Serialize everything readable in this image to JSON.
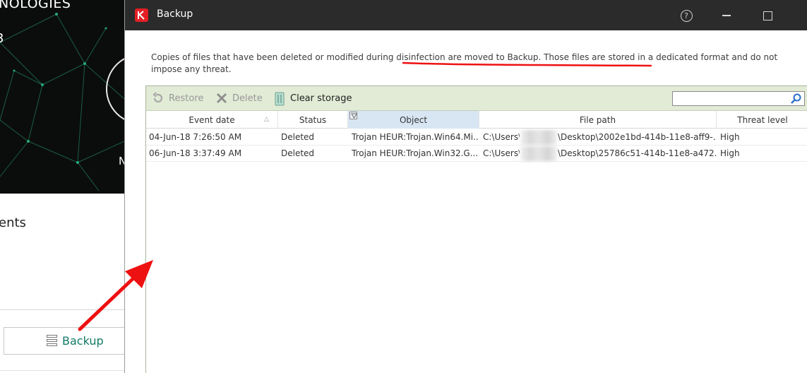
{
  "background_app": {
    "brand_text": "NOLOGIES",
    "brand_sub": "3",
    "n_text": "N",
    "section_text": "ents",
    "backup_button_label": "Backup",
    "backup_icon": "storage-icon"
  },
  "window": {
    "title": "Backup",
    "app_icon": "kaspersky-logo-icon",
    "controls": {
      "help_icon": "help-icon",
      "help_glyph": "?",
      "minimize_icon": "minimize-icon",
      "maximize_icon": "maximize-icon"
    },
    "description": "Copies of files that have been deleted or modified during disinfection are moved to Backup. Those files are stored in a dedicated format and do not impose any threat."
  },
  "toolbar": {
    "restore_label": "Restore",
    "delete_label": "Delete",
    "clear_label": "Clear storage",
    "search_value": "",
    "search_icon": "search-icon"
  },
  "table": {
    "columns": [
      "Event date",
      "Status",
      "Object",
      "File path",
      "Threat level"
    ],
    "sorted_column": "Event date",
    "active_column": "Object",
    "rows": [
      {
        "date": "04-Jun-18 7:26:50 AM",
        "status": "Deleted",
        "object": "Trojan HEUR:Trojan.Win64.Mi...",
        "path_start": "C:\\Users\\",
        "path_end": "\\Desktop\\2002e1bd-414b-11e8-aff9-...",
        "threat": "High"
      },
      {
        "date": "06-Jun-18 3:37:49 AM",
        "status": "Deleted",
        "object": "Trojan HEUR:Trojan.Win32.G...",
        "path_start": "C:\\Users\\",
        "path_end": "\\Desktop\\25786c51-414b-11e8-a472...",
        "threat": "High"
      }
    ]
  },
  "colors": {
    "titlebar": "#2b2b2b",
    "toolbar_bg": "#e2ebd6",
    "accent_red": "#e41f26",
    "link_green": "#117a66",
    "active_column": "#d8e6f3",
    "annotation": "#ee1111"
  }
}
